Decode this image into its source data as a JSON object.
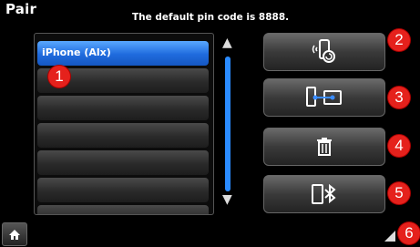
{
  "header": {
    "title": "Pair",
    "hint": "The default pin code is 8888."
  },
  "device_list": {
    "items": [
      {
        "label": "iPhone (Alx)",
        "selected": true
      },
      {
        "label": ""
      },
      {
        "label": ""
      },
      {
        "label": ""
      },
      {
        "label": ""
      },
      {
        "label": ""
      },
      {
        "label": ""
      }
    ],
    "scroll_position": 0.2
  },
  "actions": [
    {
      "name": "discoverable-button",
      "icon": "phone-search-icon"
    },
    {
      "name": "connect-button",
      "icon": "phone-link-icon"
    },
    {
      "name": "delete-button",
      "icon": "trash-icon"
    },
    {
      "name": "bluetooth-device-button",
      "icon": "bluetooth-phone-icon"
    }
  ],
  "annotations": [
    "1",
    "2",
    "3",
    "4",
    "5",
    "6"
  ],
  "colors": {
    "selected": "#1f6bdd",
    "badge": "#e5211c"
  }
}
